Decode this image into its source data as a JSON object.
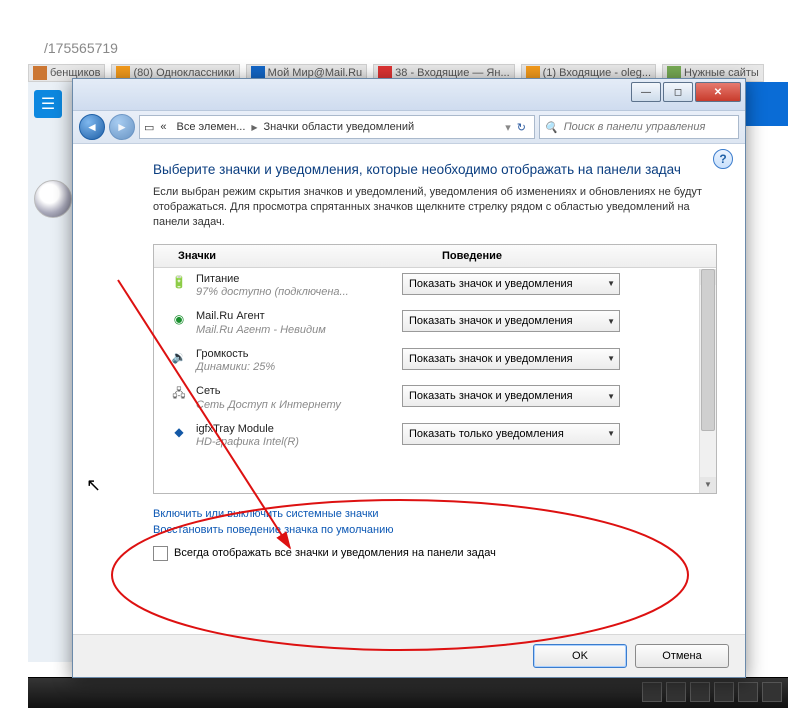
{
  "bg": {
    "url_fragment": "/175565719",
    "tabs": [
      "бенщиков",
      "(80) Одноклассники",
      "Мой Мир@Mail.Ru",
      "38 - Входящие — Ян...",
      "(1) Входящие - oleg...",
      "Нужные сайты"
    ]
  },
  "breadcrumb": {
    "seg1": "Все элемен...",
    "seg2": "Значки области уведомлений"
  },
  "search": {
    "placeholder": "Поиск в панели управления"
  },
  "heading": "Выберите значки и уведомления, которые необходимо отображать на панели задач",
  "description": "Если выбран режим скрытия значков и уведомлений, уведомления об изменениях и обновлениях не будут отображаться. Для просмотра спрятанных значков щелкните стрелку рядом с областью уведомлений на панели задач.",
  "columns": {
    "icons": "Значки",
    "behavior": "Поведение"
  },
  "rows": [
    {
      "title": "Питание",
      "subtitle": "97% доступно (подключена...",
      "option": "Показать значок и уведомления"
    },
    {
      "title": "Mail.Ru Агент",
      "subtitle": "Mail.Ru Агент - Невидим",
      "option": "Показать значок и уведомления"
    },
    {
      "title": "Громкость",
      "subtitle": "Динамики: 25%",
      "option": "Показать значок и уведомления"
    },
    {
      "title": "Сеть",
      "subtitle": "Сеть Доступ к Интернету",
      "option": "Показать значок и уведомления"
    },
    {
      "title": "igfxTray Module",
      "subtitle": "HD-графика Intel(R)",
      "option": "Показать только уведомления"
    }
  ],
  "links": {
    "toggle_system_icons": "Включить или выключить системные значки",
    "restore_defaults": "Восстановить поведение значка по умолчанию"
  },
  "checkbox_label": "Всегда отображать все значки и уведомления на панели задач",
  "buttons": {
    "ok": "OK",
    "cancel": "Отмена"
  }
}
